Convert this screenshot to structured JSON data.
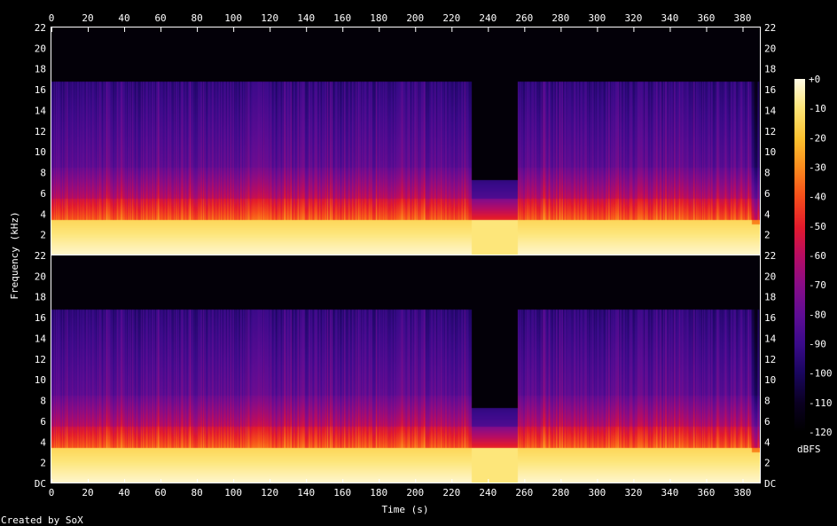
{
  "chart_data": {
    "type": "heatmap",
    "title": "",
    "xlabel": "Time (s)",
    "ylabel": "Frequency (kHz)",
    "xlim": [
      0,
      390
    ],
    "ylim": [
      0,
      22
    ],
    "x_ticks": [
      "0",
      "20",
      "40",
      "60",
      "80",
      "100",
      "120",
      "140",
      "160",
      "180",
      "200",
      "220",
      "240",
      "260",
      "280",
      "300",
      "320",
      "340",
      "360",
      "380"
    ],
    "y_ticks_top": [
      "2",
      "4",
      "6",
      "8",
      "10",
      "12",
      "14",
      "16",
      "18",
      "20",
      "22"
    ],
    "y_ticks_bottom": [
      "DC",
      "2",
      "4",
      "6",
      "8",
      "10",
      "12",
      "14",
      "16",
      "18",
      "20",
      "22"
    ],
    "colorbar": {
      "label": "dBFS",
      "ticks": [
        "+0",
        "-10",
        "-20",
        "-30",
        "-40",
        "-50",
        "-60",
        "-70",
        "-80",
        "-90",
        "-100",
        "-110",
        "-120"
      ],
      "range": [
        -120,
        0
      ]
    },
    "channels": 2,
    "band_edges_khz": [
      3.5,
      5.5,
      8.5,
      16.8
    ],
    "gap_interval_s": [
      231,
      256
    ],
    "end_drop_s": 385
  },
  "footer": {
    "credit": "Created by SoX"
  }
}
